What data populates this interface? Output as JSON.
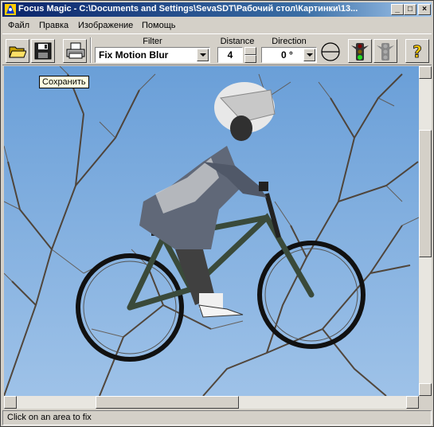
{
  "window": {
    "title": "Focus Magic - C:\\Documents and Settings\\SevaSDT\\Рабочий стол\\Картинки\\13...",
    "controls": {
      "minimize": "_",
      "maximize": "□",
      "close": "×"
    }
  },
  "menu": [
    {
      "label": "Файл"
    },
    {
      "label": "Правка"
    },
    {
      "label": "Изображение"
    },
    {
      "label": "Помощь"
    }
  ],
  "toolbar": {
    "open_icon": "folder-open-icon",
    "save_icon": "floppy-disk-icon",
    "print_icon": "printer-icon",
    "filter_label": "Filter",
    "filter_value": "Fix Motion Blur",
    "distance_label": "Distance",
    "distance_value": "4",
    "direction_label": "Direction",
    "direction_value": "0 °",
    "direction_dial_icon": "direction-dial-icon",
    "go_icon": "traffic-light-green-icon",
    "stop_icon": "traffic-light-gray-icon",
    "help_icon": "help-question-icon"
  },
  "tooltip": "Сохранить",
  "status": "Click on an area to fix",
  "colors": {
    "titlebar_start": "#0a246a",
    "titlebar_end": "#a6caf0",
    "face": "#d4d0c8",
    "sky": "#7aa7d8",
    "tooltip_bg": "#ffffe1"
  }
}
